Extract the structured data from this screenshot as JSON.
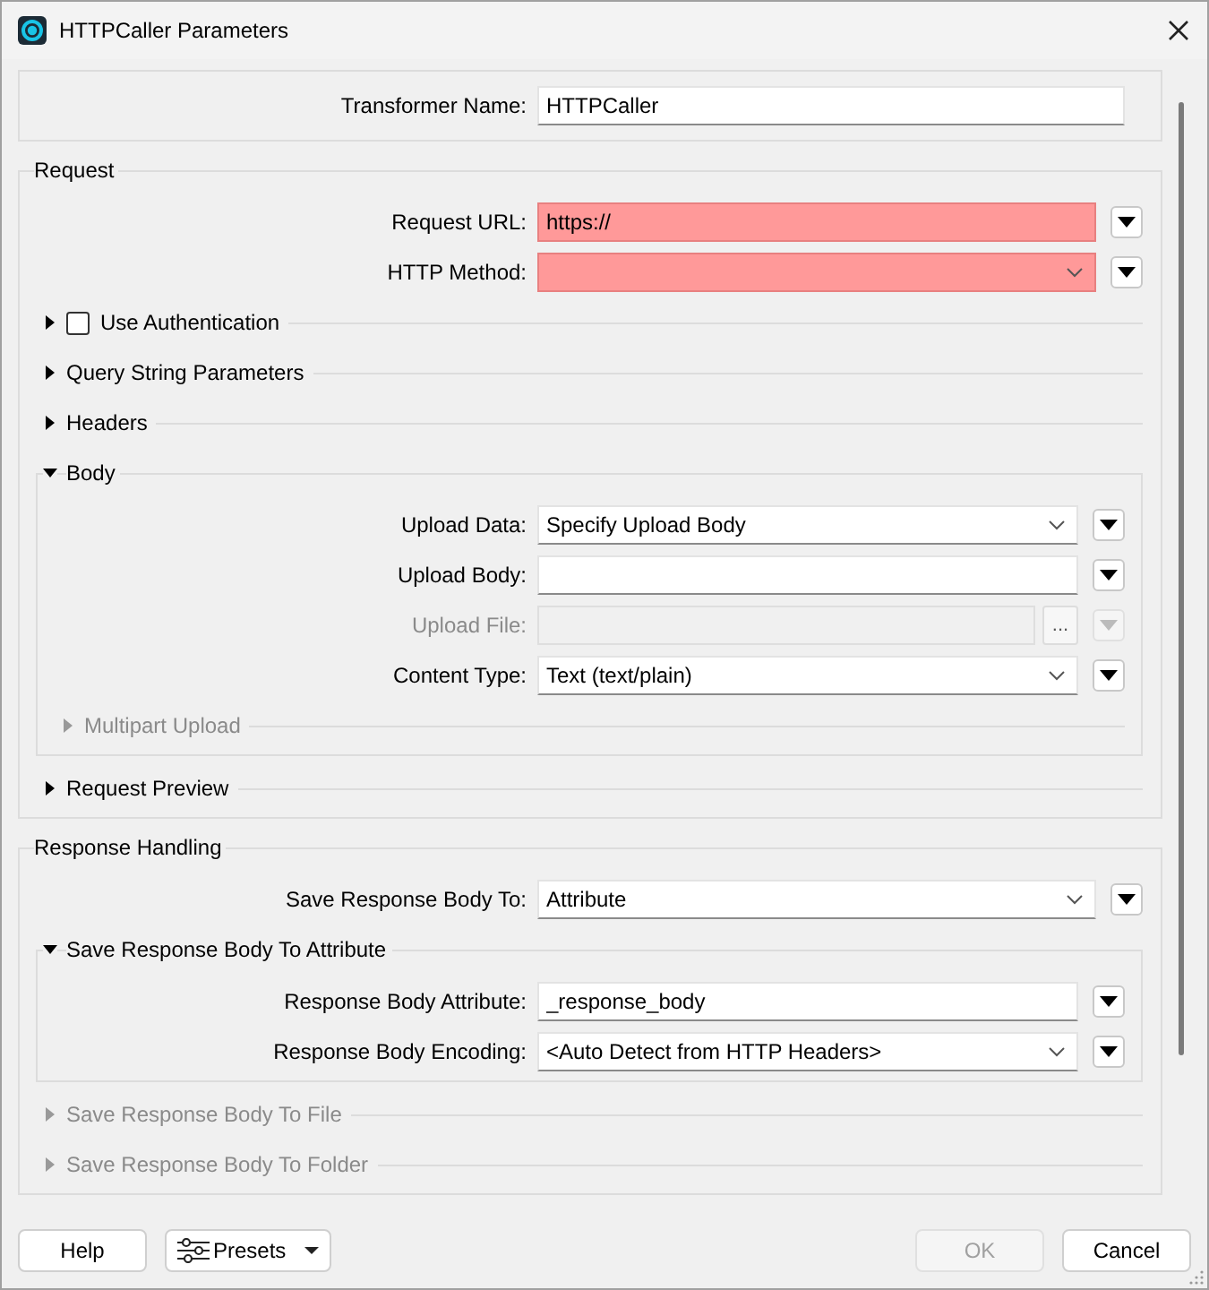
{
  "window": {
    "title": "HTTPCaller Parameters"
  },
  "name_row": {
    "label": "Transformer Name:",
    "value": "HTTPCaller"
  },
  "groups": [
    {
      "title": "Request",
      "items": [
        {
          "kind": "field",
          "label": "Request URL:",
          "value": "https://",
          "invalid": true,
          "disabled": false
        },
        {
          "kind": "dropdown",
          "label": "HTTP Method:",
          "invalid": true,
          "disabled": false
        },
        {
          "kind": "section",
          "title": "Use Authentication",
          "checked": false,
          "expanded": false,
          "disabled": false
        },
        {
          "kind": "section",
          "title": "Query String Parameters",
          "expanded": false,
          "disabled": false
        },
        {
          "kind": "section",
          "title": "Headers",
          "expanded": false,
          "disabled": false
        },
        {
          "kind": "section",
          "title": "Body",
          "expanded": true,
          "disabled": false,
          "children": [
            {
              "kind": "dropdown",
              "label": "Upload Data:",
              "value": "Specify Upload Body",
              "invalid": false,
              "disabled": false
            },
            {
              "kind": "field",
              "label": "Upload Body:",
              "invalid": false,
              "disabled": false
            },
            {
              "kind": "file",
              "label": "Upload File:",
              "browse": "...",
              "invalid": false,
              "disabled": true
            },
            {
              "kind": "dropdown",
              "label": "Content Type:",
              "value": "Text (text/plain)",
              "invalid": false,
              "disabled": false
            },
            {
              "kind": "section",
              "title": "Multipart Upload",
              "expanded": false,
              "disabled": true
            }
          ]
        },
        {
          "kind": "section",
          "title": "Request Preview",
          "expanded": false,
          "disabled": false
        }
      ]
    },
    {
      "title": "Response Handling",
      "items": [
        {
          "kind": "dropdown",
          "label": "Save Response Body To:",
          "value": "Attribute",
          "invalid": false,
          "disabled": false
        },
        {
          "kind": "section",
          "title": "Save Response Body To Attribute",
          "expanded": true,
          "disabled": false,
          "children": [
            {
              "kind": "field",
              "label": "Response Body Attribute:",
              "value": "_response_body",
              "invalid": false,
              "disabled": false
            },
            {
              "kind": "dropdown",
              "label": "Response Body Encoding:",
              "value": "<Auto Detect from HTTP Headers>",
              "invalid": false,
              "disabled": false
            }
          ]
        },
        {
          "kind": "section",
          "title": "Save Response Body To File",
          "expanded": false,
          "disabled": true
        },
        {
          "kind": "section",
          "title": "Save Response Body To Folder",
          "expanded": false,
          "disabled": true
        }
      ]
    }
  ],
  "footer": {
    "left": [
      {
        "kind": "plain",
        "label": "Help",
        "disabled": false
      },
      {
        "kind": "presets",
        "label": "Presets",
        "disabled": false
      }
    ],
    "right": [
      {
        "label": "OK",
        "disabled": true
      },
      {
        "label": "Cancel",
        "disabled": false
      }
    ]
  }
}
